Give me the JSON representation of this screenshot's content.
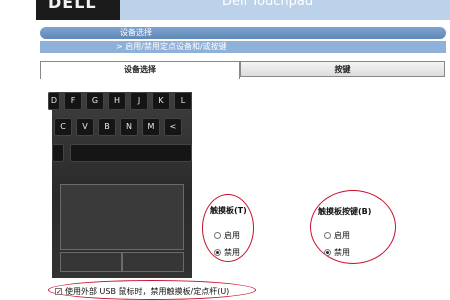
{
  "header": {
    "logo": "DELL",
    "title": "Dell Touchpad"
  },
  "nav": {
    "section": "设备选择",
    "subsection": "> 启用/禁用定点设备和/或按键"
  },
  "tabs": [
    {
      "label": "设备选择",
      "active": true
    },
    {
      "label": "按键",
      "active": false
    }
  ],
  "keyboard_keys": {
    "row1": [
      "D",
      "F",
      "G",
      "H",
      "J",
      "K",
      "L"
    ],
    "row2": [
      "C",
      "V",
      "B",
      "N",
      "M",
      "<"
    ]
  },
  "touchpad_group": {
    "label": "触摸板(T)",
    "options": [
      "启用",
      "禁用"
    ],
    "selected": "禁用"
  },
  "buttons_group": {
    "label": "触摸板按键(B)",
    "options": [
      "启用",
      "禁用"
    ],
    "selected": "禁用"
  },
  "usb_checkbox": {
    "label": "使用外部 USB 鼠标时，禁用触摸板/定点杆(U)",
    "checked": true
  },
  "colors": {
    "accent_bar": "#6f96c4",
    "header_blue": "#bcd2ea",
    "highlight_circle": "#c8102e"
  }
}
